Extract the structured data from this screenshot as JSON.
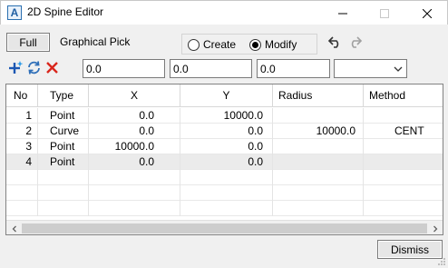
{
  "window": {
    "title": "2D Spine Editor",
    "icon": "app-a-icon"
  },
  "toolbar": {
    "full_label": "Full",
    "graphical_pick_label": "Graphical Pick",
    "create_label": "Create",
    "modify_label": "Modify",
    "mode_selected": "Modify"
  },
  "inputs": {
    "x": "0.0",
    "y": "0.0",
    "radius": "0.0",
    "method": ""
  },
  "grid": {
    "columns": [
      "No",
      "Type",
      "X",
      "Y",
      "Radius",
      "Method"
    ],
    "rows": [
      {
        "no": "1",
        "type": "Point",
        "x": "0.0",
        "y": "10000.0",
        "radius": "",
        "method": ""
      },
      {
        "no": "2",
        "type": "Curve",
        "x": "0.0",
        "y": "0.0",
        "radius": "10000.0",
        "method": "CENT"
      },
      {
        "no": "3",
        "type": "Point",
        "x": "10000.0",
        "y": "0.0",
        "radius": "",
        "method": ""
      },
      {
        "no": "4",
        "type": "Point",
        "x": "0.0",
        "y": "0.0",
        "radius": "",
        "method": ""
      }
    ],
    "selected_row": 4
  },
  "footer": {
    "dismiss_label": "Dismiss"
  },
  "colors": {
    "delete_icon": "#d9261c",
    "add_icon": "#1b57b3",
    "refresh_icon": "#2f6fb8"
  }
}
